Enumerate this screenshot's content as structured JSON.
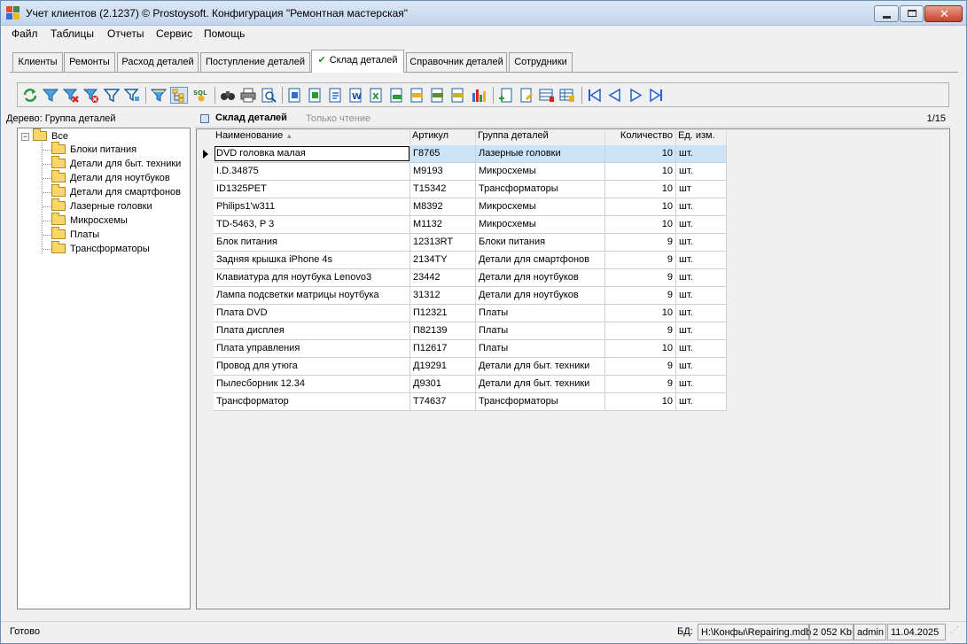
{
  "window": {
    "title": "Учет клиентов (2.1237) © Prostoysoft. Конфигурация \"Ремонтная мастерская\""
  },
  "menu": [
    "Файл",
    "Таблицы",
    "Отчеты",
    "Сервис",
    "Помощь"
  ],
  "tabs": [
    {
      "label": "Клиенты",
      "active": false
    },
    {
      "label": "Ремонты",
      "active": false
    },
    {
      "label": "Расход деталей",
      "active": false
    },
    {
      "label": "Поступление деталей",
      "active": false
    },
    {
      "label": "Склад деталей",
      "active": true
    },
    {
      "label": "Справочник деталей",
      "active": false
    },
    {
      "label": "Сотрудники",
      "active": false
    }
  ],
  "toolbar_icons": [
    "refresh-icon",
    "filter-icon",
    "filter-remove-icon",
    "filter-clear-icon",
    "filter-edit-icon",
    "filter-advanced-icon",
    "filter-tree-icon",
    "tree-icon",
    "sql-icon",
    "find-icon",
    "print-icon",
    "print-preview-icon",
    "export-icon",
    "export-excel-icon",
    "export-xml-icon",
    "export-word-icon",
    "export-csv-icon",
    "export-rtf-icon",
    "export-txt-icon",
    "export-html-icon",
    "chart-icon",
    "add-icon",
    "edit-icon",
    "columns-icon",
    "settings-icon",
    "first-record-icon",
    "prev-record-icon",
    "next-record-icon",
    "last-record-icon"
  ],
  "tree": {
    "label": "Дерево: Группа деталей",
    "root": "Все",
    "expander": "−",
    "items": [
      "Блоки питания",
      "Детали для быт. техники",
      "Детали для ноутбуков",
      "Детали для смартфонов",
      "Лазерные головки",
      "Микросхемы",
      "Платы",
      "Трансформаторы"
    ]
  },
  "grid": {
    "title": "Склад деталей",
    "mode": "Только чтение",
    "position": "1/15",
    "columns": [
      "Наименование",
      "Артикул",
      "Группа деталей",
      "Количество",
      "Ед. изм."
    ],
    "sort_indicator": "▲",
    "rows": [
      [
        "DVD головка малая",
        "Г8765",
        "Лазерные головки",
        "10",
        "шт."
      ],
      [
        "I.D.34875",
        "М9193",
        "Микросхемы",
        "10",
        "шт."
      ],
      [
        "ID1325PET",
        "Т15342",
        "Трансформаторы",
        "10",
        "шт"
      ],
      [
        "Philips1'w311",
        "М8392",
        "Микросхемы",
        "10",
        "шт."
      ],
      [
        "TD-5463, P 3",
        "М1132",
        "Микросхемы",
        "10",
        "шт."
      ],
      [
        "Блок питания",
        "12313RT",
        "Блоки питания",
        "9",
        "шт."
      ],
      [
        "Задняя крышка iPhone 4s",
        "2134TY",
        "Детали для смартфонов",
        "9",
        "шт."
      ],
      [
        "Клавиатура для ноутбука Lenovo3",
        "23442",
        "Детали для ноутбуков",
        "9",
        "шт."
      ],
      [
        "Лампа подсветки матрицы ноутбука",
        "31312",
        "Детали для ноутбуков",
        "9",
        "шт."
      ],
      [
        "Плата DVD",
        "П12321",
        "Платы",
        "10",
        "шт."
      ],
      [
        "Плата дисплея",
        "П82139",
        "Платы",
        "9",
        "шт."
      ],
      [
        "Плата управления",
        "П12617",
        "Платы",
        "10",
        "шт."
      ],
      [
        "Провод для утюга",
        "Д19291",
        "Детали для быт. техники",
        "9",
        "шт."
      ],
      [
        "Пылесборник 12.34",
        "Д9301",
        "Детали для быт. техники",
        "9",
        "шт."
      ],
      [
        "Трансформатор",
        "Т74637",
        "Трансформаторы",
        "10",
        "шт."
      ]
    ],
    "selected_row": 0
  },
  "status": {
    "text": "Готово",
    "db_label": "БД:",
    "db_path": "H:\\Конфы\\Repairing.mdb",
    "db_size": "2 052 Kb",
    "user": "admin",
    "date": "11.04.2025"
  },
  "colors": {
    "selected_row": "#cce4f7",
    "folder": "#f7d66b",
    "nav_arrow": "#1f5fd1"
  }
}
